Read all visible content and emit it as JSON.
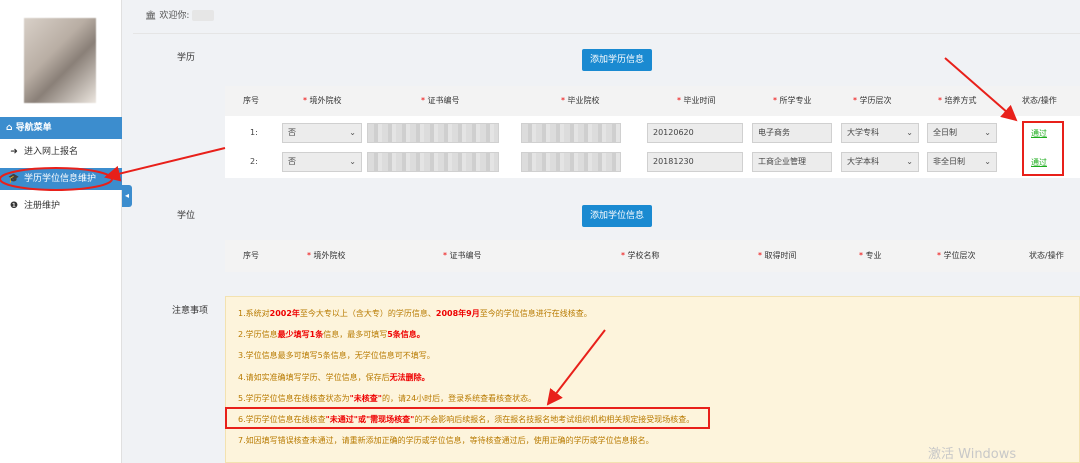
{
  "sidebar": {
    "nav_header": "导航菜单",
    "items": [
      {
        "label": "进入网上报名",
        "icon": "sign-in-icon"
      },
      {
        "label": "学历学位信息维护",
        "icon": "graduation-cap-icon"
      },
      {
        "label": "注册维护",
        "icon": "info-icon"
      }
    ],
    "collapse_glyph": "◂"
  },
  "header": {
    "welcome": "欢迎你:"
  },
  "education": {
    "label": "学历",
    "add_button": "添加学历信息",
    "columns": [
      "序号",
      "境外院校",
      "证书编号",
      "毕业院校",
      "毕业时间",
      "所学专业",
      "学历层次",
      "培养方式",
      "状态/操作"
    ],
    "rows": [
      {
        "index": "1:",
        "overseas": "否",
        "cert": "",
        "school": "",
        "grad_time": "20120620",
        "major": "电子商务",
        "level": "大学专科",
        "mode": "全日制",
        "status": "通过"
      },
      {
        "index": "2:",
        "overseas": "否",
        "cert": "",
        "school": "",
        "grad_time": "20181230",
        "major": "工商企业管理",
        "level": "大学本科",
        "mode": "非全日制",
        "status": "通过"
      }
    ]
  },
  "degree": {
    "label": "学位",
    "add_button": "添加学位信息",
    "columns": [
      "序号",
      "境外院校",
      "证书编号",
      "学校名称",
      "取得时间",
      "专业",
      "学位层次",
      "状态/操作"
    ]
  },
  "notice": {
    "label": "注意事项",
    "lines": [
      {
        "pre": "1.系统对",
        "b1": "2002年",
        "mid1": "至今大专以上（含大专）的学历信息、",
        "b2": "2008年9月",
        "post": "至今的学位信息进行在线核查。"
      },
      {
        "pre": "2.学历信息",
        "b1": "最少填写1条",
        "mid1": "信息，最多可填写",
        "b2": "5条信息。",
        "post": ""
      },
      {
        "pre": "3.学位信息最多可填写5条信息，无学位信息可不填写。",
        "b1": "",
        "mid1": "",
        "b2": "",
        "post": ""
      },
      {
        "pre": "4.请如实准确填写学历、学位信息，保存后",
        "b1": "无法删除。",
        "mid1": "",
        "b2": "",
        "post": ""
      },
      {
        "pre": "5.学历学位信息在线核查状态为",
        "b1": "\"未核查\"",
        "mid1": "的，请24小时后，登录系统查看核查状态。",
        "b2": "",
        "post": ""
      },
      {
        "pre": "6.学历学位信息在线核查",
        "b1": "\"未通过\"或\"需现场核查\"",
        "mid1": "的不会影响后续报名，须在报名技报名地考试组织机构相关规定接受现场核查。",
        "b2": "",
        "post": ""
      },
      {
        "pre": "7.如因填写错误核查未通过，请重新添加正确的学历或学位信息，等待核查通过后，使用正确的学历或学位信息报名。",
        "b1": "",
        "mid1": "",
        "b2": "",
        "post": ""
      }
    ]
  },
  "watermark": "激活 Windows",
  "colors": {
    "accent": "#3c8dce",
    "button": "#1a8ad1",
    "pass": "#1dad1d",
    "highlight": "#e8201a",
    "notice_bg": "#fdf4dc"
  }
}
